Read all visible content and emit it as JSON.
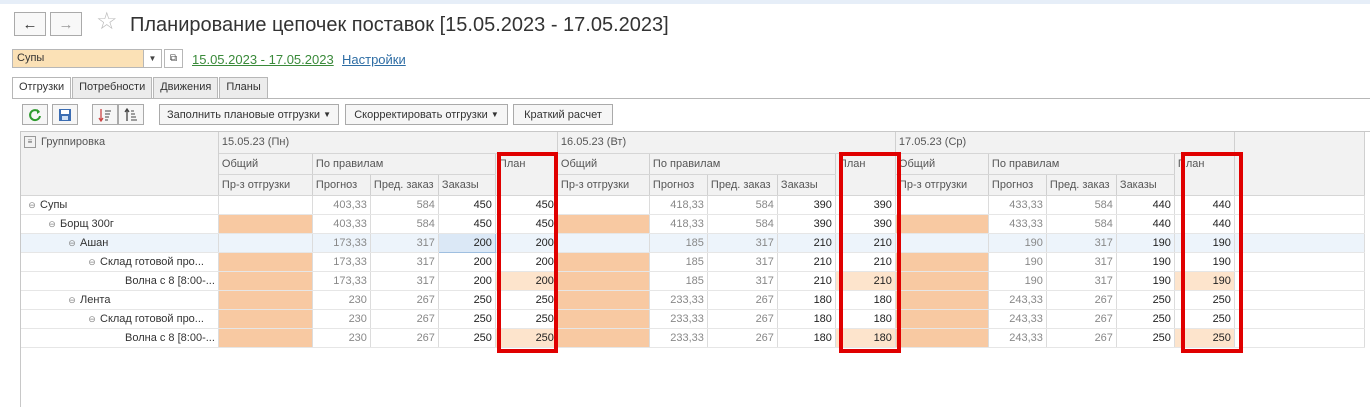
{
  "window": {
    "title": "Планирование цепочек поставок [15.05.2023 - 17.05.2023]",
    "back_icon": "←",
    "forward_icon": "→",
    "star_icon": "☆"
  },
  "filter": {
    "group_value": "Супы",
    "period_link": "15.05.2023 - 17.05.2023",
    "settings_link": "Настройки"
  },
  "tabs": [
    {
      "label": "Отгрузки",
      "active": true
    },
    {
      "label": "Потребности",
      "active": false
    },
    {
      "label": "Движения",
      "active": false
    },
    {
      "label": "Планы",
      "active": false
    }
  ],
  "toolbar": {
    "fill_label": "Заполнить плановые отгрузки",
    "adjust_label": "Скорректировать отгрузки",
    "calc_label": "Краткий расчет"
  },
  "grid": {
    "grouping_label": "Группировка",
    "days": [
      {
        "label": "15.05.23 (Пн)"
      },
      {
        "label": "16.05.23 (Вт)"
      },
      {
        "label": "17.05.23 (Ср)"
      }
    ],
    "subhead": {
      "common": "Общий",
      "by_rules": "По правилам",
      "plan": "План",
      "ship": "Пр-з отгрузки",
      "forecast": "Прогноз",
      "prev_order": "Пред. заказ",
      "orders": "Заказы"
    },
    "rows": [
      {
        "label": "Супы",
        "level": 0,
        "toggle": "⊖",
        "d": [
          [
            "403,33",
            "584",
            "450",
            "450"
          ],
          [
            "418,33",
            "584",
            "390",
            "390"
          ],
          [
            "433,33",
            "584",
            "440",
            "440"
          ]
        ]
      },
      {
        "label": "Борщ 300г",
        "level": 1,
        "toggle": "⊖",
        "d": [
          [
            "403,33",
            "584",
            "450",
            "450"
          ],
          [
            "418,33",
            "584",
            "390",
            "390"
          ],
          [
            "433,33",
            "584",
            "440",
            "440"
          ]
        ]
      },
      {
        "label": "Ашан",
        "level": 2,
        "toggle": "⊖",
        "highlight": true,
        "d": [
          [
            "173,33",
            "317",
            "200",
            "200"
          ],
          [
            "185",
            "317",
            "210",
            "210"
          ],
          [
            "190",
            "317",
            "190",
            "190"
          ]
        ]
      },
      {
        "label": "Склад готовой про...",
        "level": 3,
        "toggle": "⊖",
        "d": [
          [
            "173,33",
            "317",
            "200",
            "200"
          ],
          [
            "185",
            "317",
            "210",
            "210"
          ],
          [
            "190",
            "317",
            "190",
            "190"
          ]
        ]
      },
      {
        "label": "Волна с 8 [8:00-...",
        "level": 4,
        "toggle": "",
        "leaf": true,
        "d": [
          [
            "173,33",
            "317",
            "200",
            "200"
          ],
          [
            "185",
            "317",
            "210",
            "210"
          ],
          [
            "190",
            "317",
            "190",
            "190"
          ]
        ]
      },
      {
        "label": "Лента",
        "level": 2,
        "toggle": "⊖",
        "d": [
          [
            "230",
            "267",
            "250",
            "250"
          ],
          [
            "233,33",
            "267",
            "180",
            "180"
          ],
          [
            "243,33",
            "267",
            "250",
            "250"
          ]
        ]
      },
      {
        "label": "Склад готовой про...",
        "level": 3,
        "toggle": "⊖",
        "d": [
          [
            "230",
            "267",
            "250",
            "250"
          ],
          [
            "233,33",
            "267",
            "180",
            "180"
          ],
          [
            "243,33",
            "267",
            "250",
            "250"
          ]
        ]
      },
      {
        "label": "Волна с 8 [8:00-...",
        "level": 4,
        "toggle": "",
        "leaf": true,
        "d": [
          [
            "230",
            "267",
            "250",
            "250"
          ],
          [
            "233,33",
            "267",
            "180",
            "180"
          ],
          [
            "243,33",
            "267",
            "250",
            "250"
          ]
        ]
      }
    ]
  }
}
